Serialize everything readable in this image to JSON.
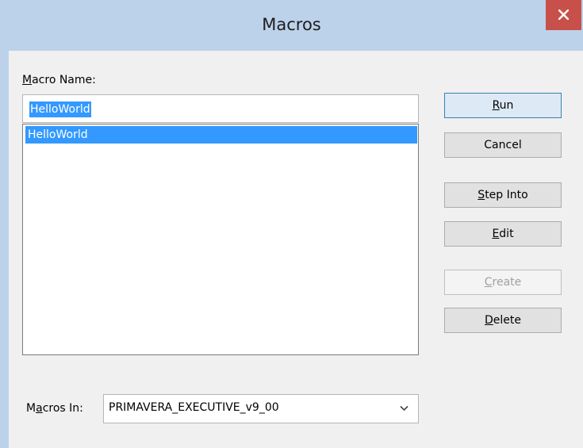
{
  "window": {
    "title": "Macros"
  },
  "form": {
    "macro_name_label": "Macro Name:",
    "macro_name_value": "HelloWorld",
    "macros_list": [
      "HelloWorld"
    ],
    "macros_in_label": "Macros In:",
    "macros_in_value": "PRIMAVERA_EXECUTIVE_v9_00"
  },
  "buttons": {
    "run": "Run",
    "cancel": "Cancel",
    "step_into": "Step Into",
    "edit": "Edit",
    "create": "Create",
    "delete": "Delete"
  },
  "icons": {
    "close": "close-icon",
    "dropdown": "chevron-down-icon"
  }
}
